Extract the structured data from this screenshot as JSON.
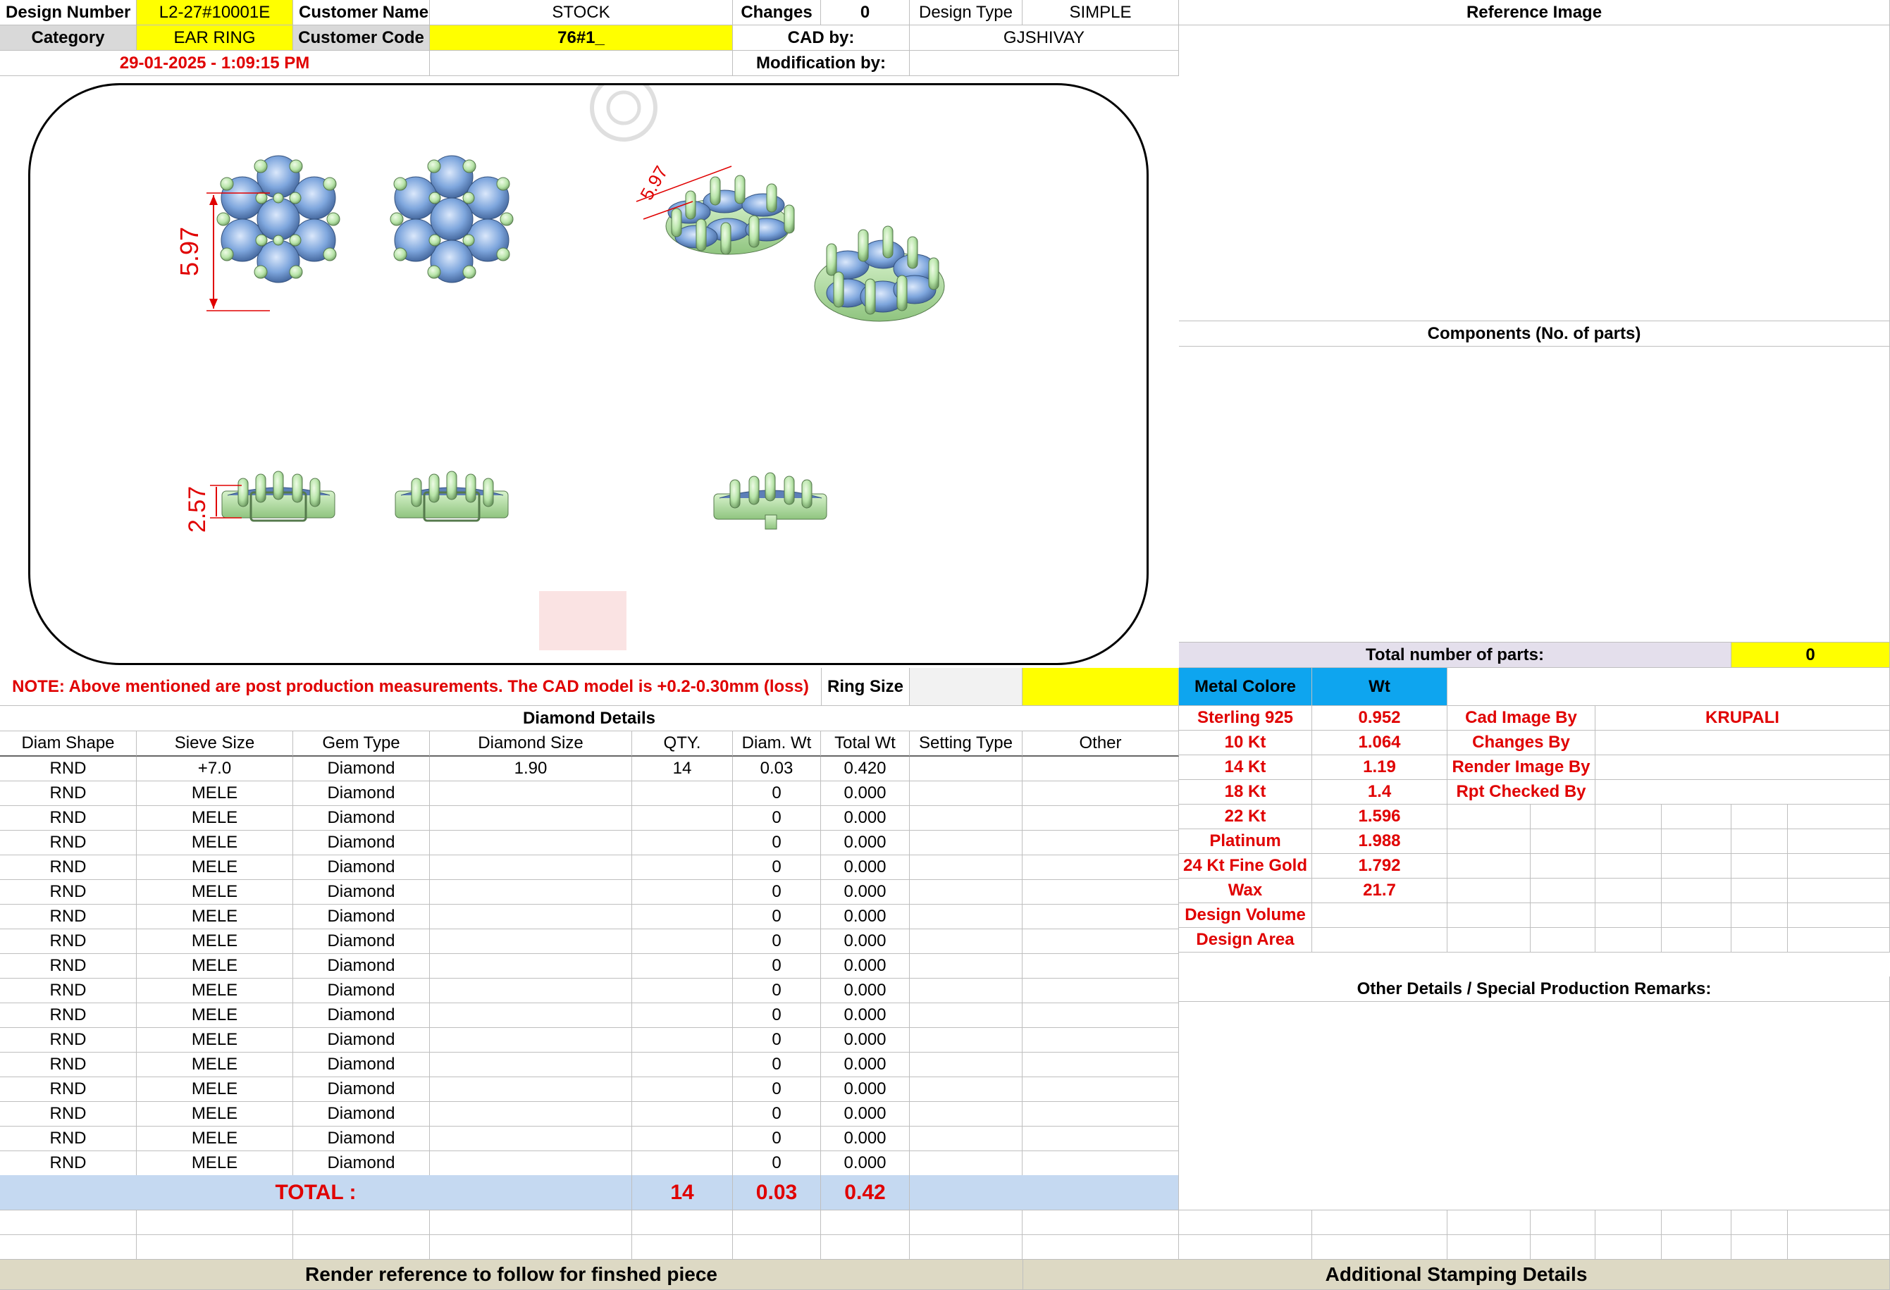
{
  "header": {
    "design_number_label": "Design Number",
    "design_number": "L2-27#10001E",
    "customer_name_label": "Customer Name",
    "customer_name": "STOCK",
    "changes_label": "Changes",
    "changes": "0",
    "design_type_label": "Design Type",
    "design_type": "SIMPLE",
    "reference_image_label": "Reference Image",
    "category_label": "Category",
    "category": "EAR RING",
    "customer_code_label": "Customer Code",
    "customer_code": "76#1_",
    "cad_by_label": "CAD by:",
    "cad_by": "GJSHIVAY",
    "timestamp": "29-01-2025 - 1:09:15 PM",
    "modification_by_label": "Modification by:",
    "modification_by": ""
  },
  "drawing": {
    "dim_width": "5.97",
    "dim_height": "2.57",
    "dim_small": "5.97"
  },
  "components": {
    "title": "Components (No. of parts)",
    "total_parts_label": "Total number of parts:",
    "total_parts": "0"
  },
  "note": {
    "text": "NOTE: Above mentioned are post production measurements. The CAD model is +0.2-0.30mm (loss)",
    "ring_size_label": "Ring Size",
    "ring_size": ""
  },
  "diamond_details": {
    "title": "Diamond Details",
    "columns": [
      "Diam Shape",
      "Sieve Size",
      "Gem Type",
      "Diamond Size",
      "QTY.",
      "Diam. Wt",
      "Total Wt",
      "Setting Type",
      "Other"
    ],
    "rows": [
      [
        "RND",
        "+7.0",
        "Diamond",
        "1.90",
        "14",
        "0.03",
        "0.420",
        "",
        ""
      ],
      [
        "RND",
        "MELE",
        "Diamond",
        "",
        "",
        "0",
        "0.000",
        "",
        ""
      ],
      [
        "RND",
        "MELE",
        "Diamond",
        "",
        "",
        "0",
        "0.000",
        "",
        ""
      ],
      [
        "RND",
        "MELE",
        "Diamond",
        "",
        "",
        "0",
        "0.000",
        "",
        ""
      ],
      [
        "RND",
        "MELE",
        "Diamond",
        "",
        "",
        "0",
        "0.000",
        "",
        ""
      ],
      [
        "RND",
        "MELE",
        "Diamond",
        "",
        "",
        "0",
        "0.000",
        "",
        ""
      ],
      [
        "RND",
        "MELE",
        "Diamond",
        "",
        "",
        "0",
        "0.000",
        "",
        ""
      ],
      [
        "RND",
        "MELE",
        "Diamond",
        "",
        "",
        "0",
        "0.000",
        "",
        ""
      ],
      [
        "RND",
        "MELE",
        "Diamond",
        "",
        "",
        "0",
        "0.000",
        "",
        ""
      ],
      [
        "RND",
        "MELE",
        "Diamond",
        "",
        "",
        "0",
        "0.000",
        "",
        ""
      ],
      [
        "RND",
        "MELE",
        "Diamond",
        "",
        "",
        "0",
        "0.000",
        "",
        ""
      ],
      [
        "RND",
        "MELE",
        "Diamond",
        "",
        "",
        "0",
        "0.000",
        "",
        ""
      ],
      [
        "RND",
        "MELE",
        "Diamond",
        "",
        "",
        "0",
        "0.000",
        "",
        ""
      ],
      [
        "RND",
        "MELE",
        "Diamond",
        "",
        "",
        "0",
        "0.000",
        "",
        ""
      ],
      [
        "RND",
        "MELE",
        "Diamond",
        "",
        "",
        "0",
        "0.000",
        "",
        ""
      ],
      [
        "RND",
        "MELE",
        "Diamond",
        "",
        "",
        "0",
        "0.000",
        "",
        ""
      ],
      [
        "RND",
        "MELE",
        "Diamond",
        "",
        "",
        "0",
        "0.000",
        "",
        ""
      ]
    ],
    "total_label": "TOTAL :",
    "total_qty": "14",
    "total_diam_wt": "0.03",
    "total_wt": "0.42"
  },
  "metal": {
    "metal_color_label": "Metal Colore",
    "wt_label": "Wt",
    "rows": [
      [
        "Sterling 925",
        "0.952"
      ],
      [
        "10 Kt",
        "1.064"
      ],
      [
        "14 Kt",
        "1.19"
      ],
      [
        "18 Kt",
        "1.4"
      ],
      [
        "22 Kt",
        "1.596"
      ],
      [
        "Platinum",
        "1.988"
      ],
      [
        "24 Kt Fine Gold",
        "1.792"
      ],
      [
        "Wax",
        "21.7"
      ],
      [
        "Design Volume",
        ""
      ],
      [
        "Design Area",
        ""
      ]
    ]
  },
  "credits": {
    "rows": [
      [
        "Cad Image By",
        "KRUPALI"
      ],
      [
        "Changes By",
        ""
      ],
      [
        "Render Image By",
        ""
      ],
      [
        "Rpt Checked By",
        ""
      ]
    ]
  },
  "other_details_title": "Other Details / Special Production Remarks:",
  "footer": {
    "render_reference": "Render reference to follow for finshed piece",
    "stamping": "Additional Stamping Details"
  },
  "colors": {
    "yellow": "#ffff00",
    "red_text": "#e00000",
    "metal_header_blue": "#0ea5ef",
    "total_row": "#c5d9f1",
    "footer": "#ddd9c4",
    "diamond_blue": "#7ea6dd",
    "metal_green": "#b7e4a8"
  }
}
